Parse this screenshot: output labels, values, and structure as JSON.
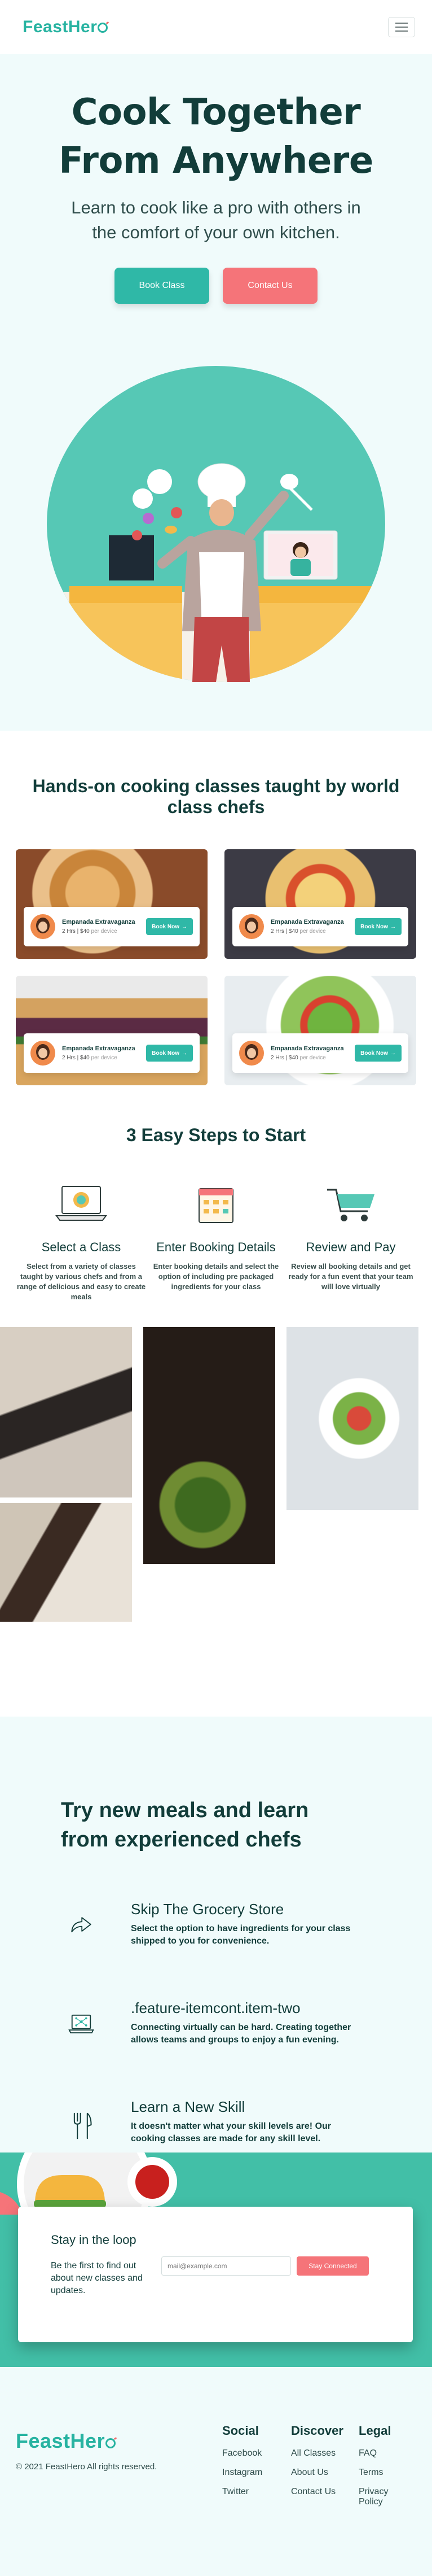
{
  "brand": {
    "name": "FeastHero",
    "accent": "#27b3a1",
    "accent_pink": "#f57479"
  },
  "nav": {
    "menu_icon": "hamburger-icon"
  },
  "hero": {
    "title_line1": "Cook Together",
    "title_line2": "From Anywhere",
    "subtitle_line1": "Learn to cook like a pro with others in",
    "subtitle_line2": "the comfort of your own kitchen.",
    "primary_button": "Book Class",
    "secondary_button": "Contact Us"
  },
  "classes": {
    "heading": "Hands-on cooking classes taught by world class chefs",
    "cards": [
      {
        "title": "Empanada Extravaganza",
        "meta": "2 Hrs | $40",
        "meta_suffix": " per device",
        "button": "Book Now"
      },
      {
        "title": "Empanada Extravaganza",
        "meta": "2 Hrs | $40",
        "meta_suffix": " per device",
        "button": "Book Now"
      },
      {
        "title": "Empanada Extravaganza",
        "meta": "2 Hrs | $40",
        "meta_suffix": " per device",
        "button": "Book Now"
      },
      {
        "title": "Empanada Extravaganza",
        "meta": "2 Hrs | $40",
        "meta_suffix": " per device",
        "button": "Book Now"
      }
    ]
  },
  "steps": {
    "heading": "3 Easy Steps to Start",
    "items": [
      {
        "title": "Select a Class",
        "text": "Select from a variety of classes taught by various chefs and from a range of delicious and easy to create meals"
      },
      {
        "title": "Enter Booking Details",
        "text": "Enter booking details and select the option of including pre packaged ingredients for your class"
      },
      {
        "title": "Review and Pay",
        "text": "Review all booking details and get ready for a fun event that your team will love virtually"
      }
    ]
  },
  "features": {
    "heading_line1": "Try new meals and learn",
    "heading_line2": "from experienced chefs",
    "items": [
      {
        "title": "Skip The Grocery Store",
        "text": "Select the option to have ingredients for your class shipped to you for convenience."
      },
      {
        "title": ".feature-itemcont.item-two",
        "text": "Connecting virtually can be hard. Creating together allows teams and groups to enjoy a fun evening."
      },
      {
        "title": "Learn a New Skill",
        "text": "It doesn't matter what your skill levels are! Our cooking classes are made for any skill level."
      }
    ]
  },
  "newsletter": {
    "title": "Stay in the loop",
    "text": "Be the first to find out about new classes and updates.",
    "placeholder": "mail@example.com",
    "button": "Stay Connected"
  },
  "footer": {
    "copyright": "© 2021 FeastHero All rights reserved.",
    "columns": [
      {
        "heading": "Social",
        "links": [
          "Facebook",
          "Instagram",
          "Twitter"
        ]
      },
      {
        "heading": "Discover",
        "links": [
          "All Classes",
          "About Us",
          "Contact Us"
        ]
      },
      {
        "heading": "Legal",
        "links": [
          "FAQ",
          "Terms",
          "Privacy Policy"
        ]
      }
    ]
  }
}
